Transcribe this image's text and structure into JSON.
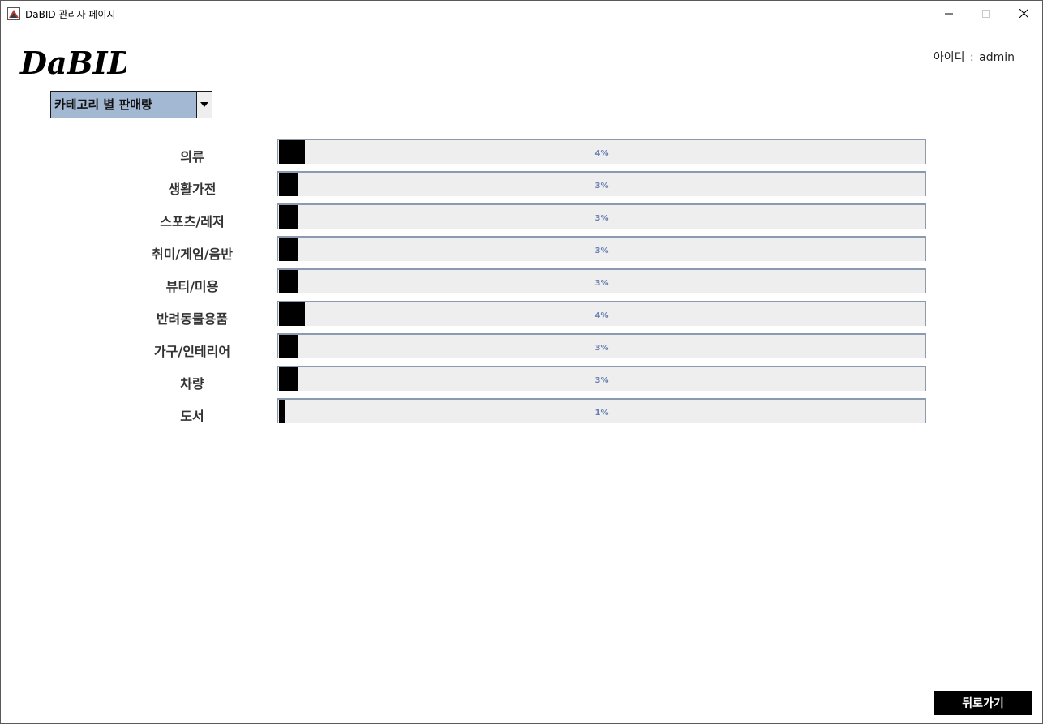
{
  "window": {
    "title": "DaBID 관리자 페이지"
  },
  "header": {
    "logo_text": "DaBID",
    "user_id_label": "아이디",
    "user_id_separator": ":",
    "user_id_value": "admin"
  },
  "category_select": {
    "selected": "카테고리 별 판매량"
  },
  "sales_by_category": [
    {
      "label": "의류",
      "percent_text": "4%",
      "value": 4
    },
    {
      "label": "생활가전",
      "percent_text": "3%",
      "value": 3
    },
    {
      "label": "스포츠/레저",
      "percent_text": "3%",
      "value": 3
    },
    {
      "label": "취미/게임/음반",
      "percent_text": "3%",
      "value": 3
    },
    {
      "label": "뷰티/미용",
      "percent_text": "3%",
      "value": 3
    },
    {
      "label": "반려동물용품",
      "percent_text": "4%",
      "value": 4
    },
    {
      "label": "가구/인테리어",
      "percent_text": "3%",
      "value": 3
    },
    {
      "label": "차량",
      "percent_text": "3%",
      "value": 3
    },
    {
      "label": "도서",
      "percent_text": "1%",
      "value": 1
    }
  ],
  "footer": {
    "back_label": "뒤로가기"
  },
  "colors": {
    "select_bg": "#a3b8d3",
    "bar_fill": "#000000",
    "bar_track": "#eeeeee",
    "bar_text": "#6a7fb0",
    "back_button_bg": "#000000"
  }
}
